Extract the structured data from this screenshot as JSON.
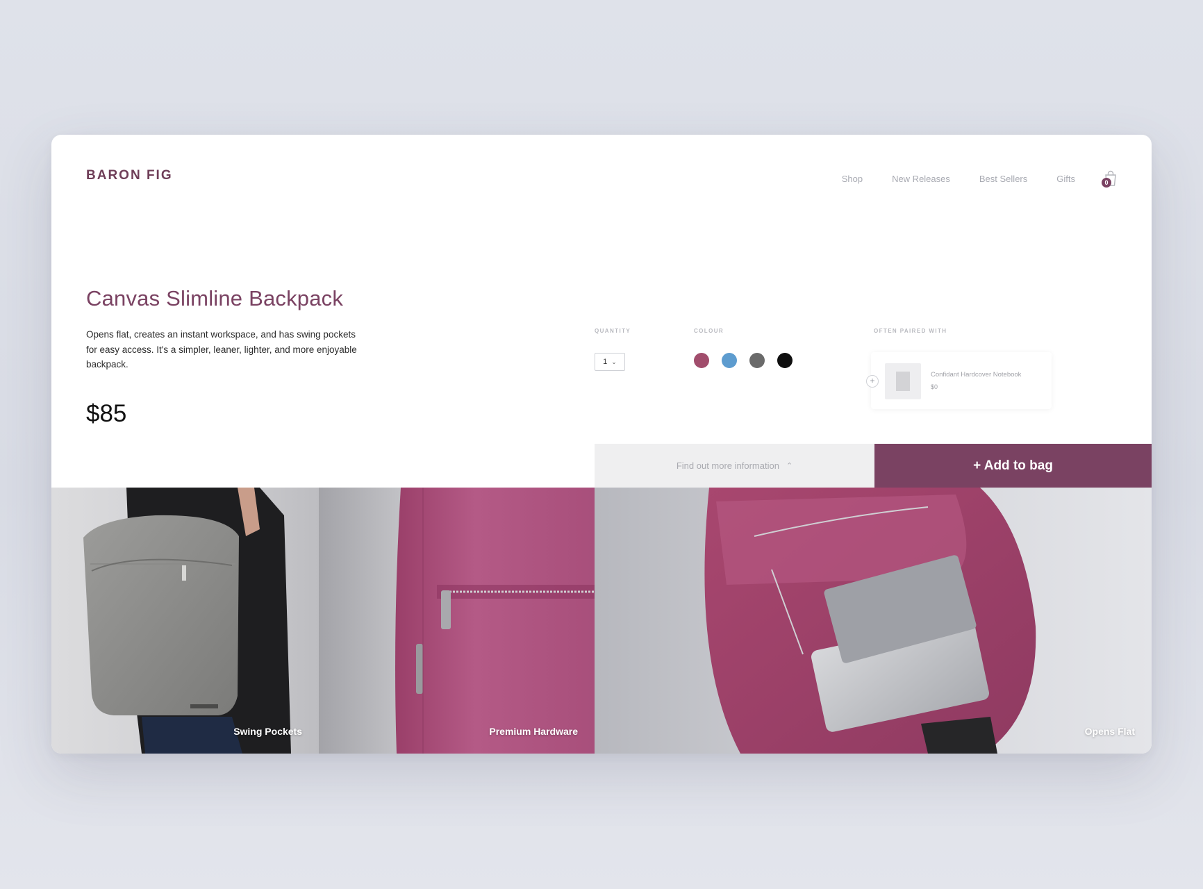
{
  "brand": {
    "logo": "BARON FIG",
    "accent": "#7a4262"
  },
  "nav": {
    "items": [
      "Shop",
      "New Releases",
      "Best Sellers",
      "Gifts"
    ],
    "bag_icon": "shopping-bag-icon",
    "bag_count": "0"
  },
  "product": {
    "title": "Canvas Slimline Backpack",
    "description": "Opens flat, creates an instant workspace, and has swing pockets for easy access. It's a simpler, leaner, lighter, and more enjoyable backpack.",
    "price": "$85"
  },
  "options": {
    "quantity_label": "QUANTITY",
    "quantity_value": "1",
    "colour_label": "COLOUR",
    "colours": [
      {
        "name": "plum",
        "hex": "#a14d6c"
      },
      {
        "name": "blue",
        "hex": "#5d9ccf"
      },
      {
        "name": "grey",
        "hex": "#6a6a6a"
      },
      {
        "name": "black",
        "hex": "#0f0f0f"
      }
    ],
    "paired_label": "OFTEN PAIRED WITH",
    "paired_item": {
      "name": "Confidant Hardcover Notebook",
      "price": "$0"
    }
  },
  "actions": {
    "more_info": "Find out more information",
    "add_to_bag": "+ Add to bag"
  },
  "gallery": [
    {
      "caption": "Swing Pockets"
    },
    {
      "caption": "Premium Hardware"
    },
    {
      "caption": "Opens Flat"
    }
  ]
}
